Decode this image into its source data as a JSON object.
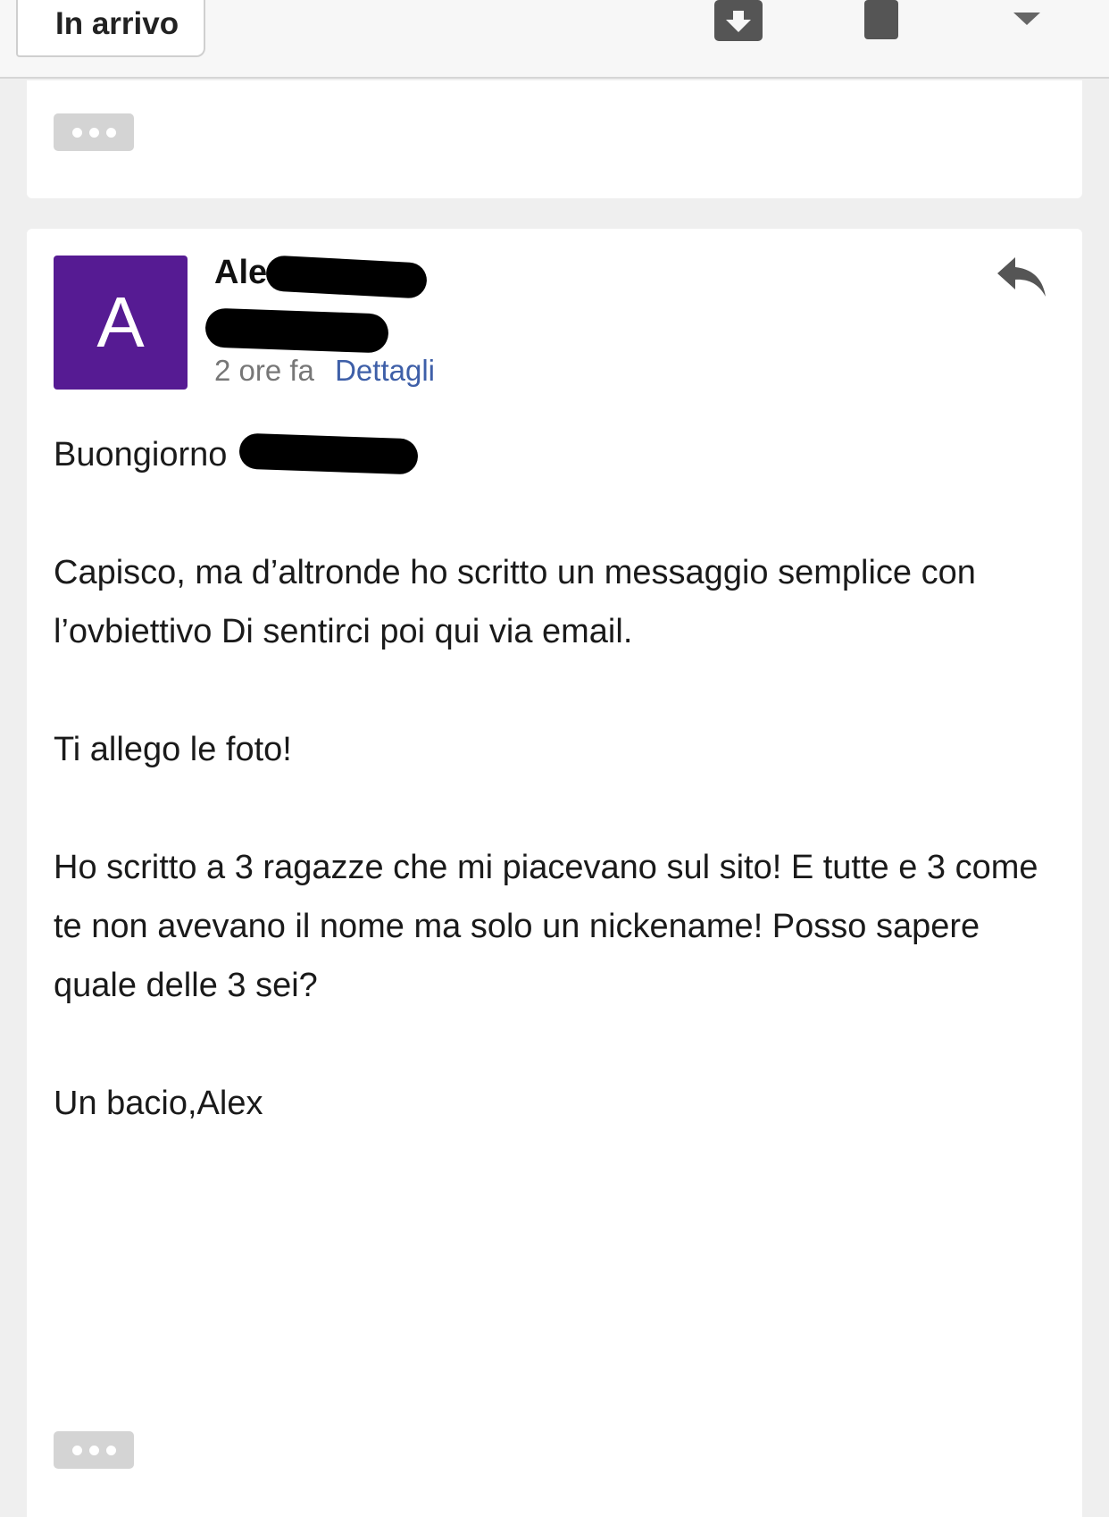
{
  "toolbar": {
    "back_label": "In arrivo",
    "icons": [
      "archive-icon",
      "trash-icon",
      "more-dropdown-icon"
    ]
  },
  "message": {
    "avatar_letter": "A",
    "avatar_color": "#561b93",
    "sender_name_visible": "Ale",
    "time_ago": "2 ore fa",
    "details_link": "Dettagli",
    "greeting": "Buongiorno",
    "paragraphs": [
      "Capisco, ma d’altronde ho scritto un messaggio semplice con l’ovbiettivo Di sentirci poi qui via email.",
      "Ti allego le foto!",
      "Ho scritto a 3 ragazze che mi piacevano sul sito! E tutte e 3 come te non avevano il nome ma solo un nickename! Posso sapere quale delle 3 sei?",
      "Un bacio,Alex"
    ]
  },
  "colors": {
    "accent_link": "#3e5fa8",
    "background": "#efefef"
  }
}
